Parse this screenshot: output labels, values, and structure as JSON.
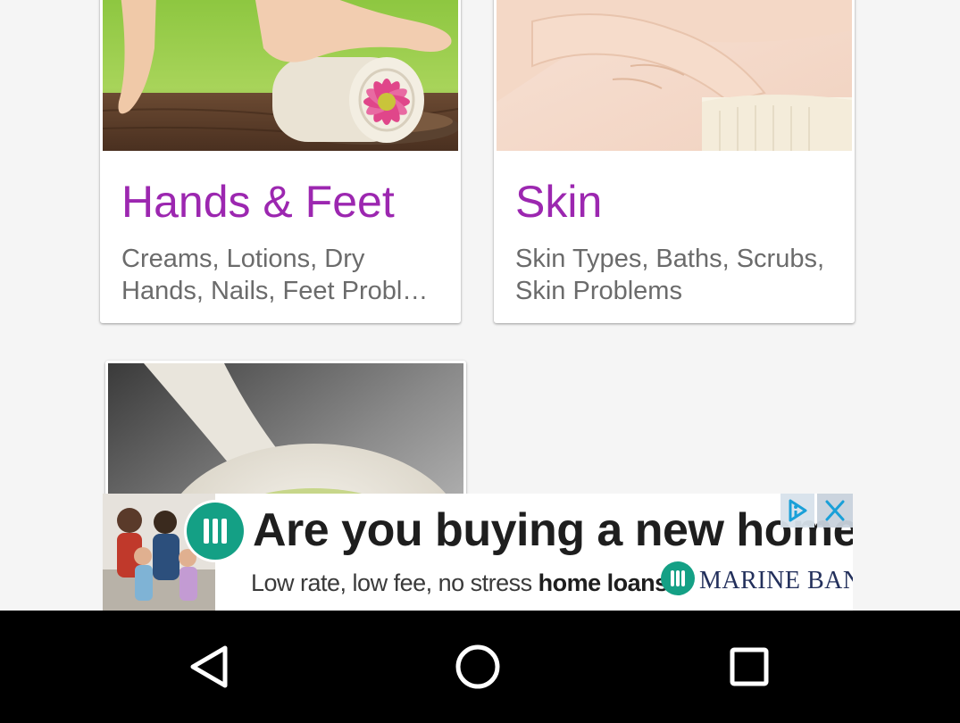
{
  "cards": [
    {
      "title": "Hands & Feet",
      "desc_line1": "Creams, Lotions, Dry",
      "desc_line2": "Hands, Nails, Feet Probl…",
      "image": "hands-feet-photo"
    },
    {
      "title": "Skin",
      "desc_line1": "Skin Types, Baths, Scrubs,",
      "desc_line2": "Skin Problems",
      "image": "skin-photo"
    },
    {
      "image": "spoon-scrub-photo"
    }
  ],
  "ad": {
    "headline": "Are you buying a new home?",
    "subline_prefix": "Low rate, low fee, no stress ",
    "subline_bold": "home loans",
    "brand": "MARINE BANK",
    "adchoices_icon": "adchoices-icon",
    "close_icon": "close-icon"
  },
  "nav": {
    "back_icon": "back-triangle-icon",
    "home_icon": "home-circle-icon",
    "recents_icon": "recents-square-icon"
  },
  "colors": {
    "title": "#9c27b0",
    "description": "#6b6b6b",
    "background": "#f5f5f5",
    "nav_bar": "#000000",
    "bank_teal": "#14a085"
  }
}
